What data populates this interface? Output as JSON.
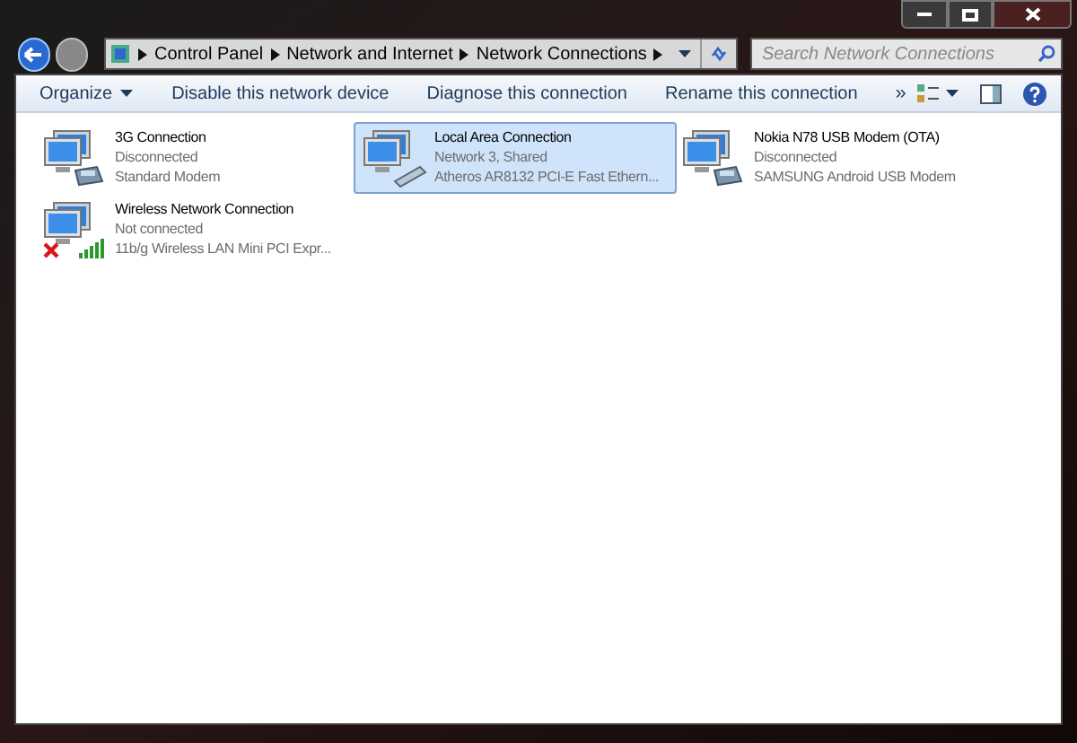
{
  "breadcrumb": [
    "Control Panel",
    "Network and Internet",
    "Network Connections"
  ],
  "search": {
    "placeholder": "Search Network Connections"
  },
  "toolbar": {
    "organize": "Organize",
    "commands": [
      "Disable this network device",
      "Diagnose this connection",
      "Rename this connection"
    ],
    "more": "»"
  },
  "connections": [
    {
      "name": "3G Connection",
      "status": "Disconnected",
      "device": "Standard Modem",
      "kind": "modem",
      "selected": false
    },
    {
      "name": "Local Area Connection",
      "status": "Network  3, Shared",
      "device": "Atheros AR8132 PCI-E Fast Ethern...",
      "kind": "ethernet",
      "selected": true
    },
    {
      "name": "Nokia N78 USB Modem (OTA)",
      "status": "Disconnected",
      "device": "SAMSUNG Android USB Modem",
      "kind": "modem",
      "selected": false
    },
    {
      "name": "Wireless Network Connection",
      "status": "Not connected",
      "device": "11b/g Wireless LAN Mini PCI Expr...",
      "kind": "wireless",
      "selected": false
    }
  ]
}
